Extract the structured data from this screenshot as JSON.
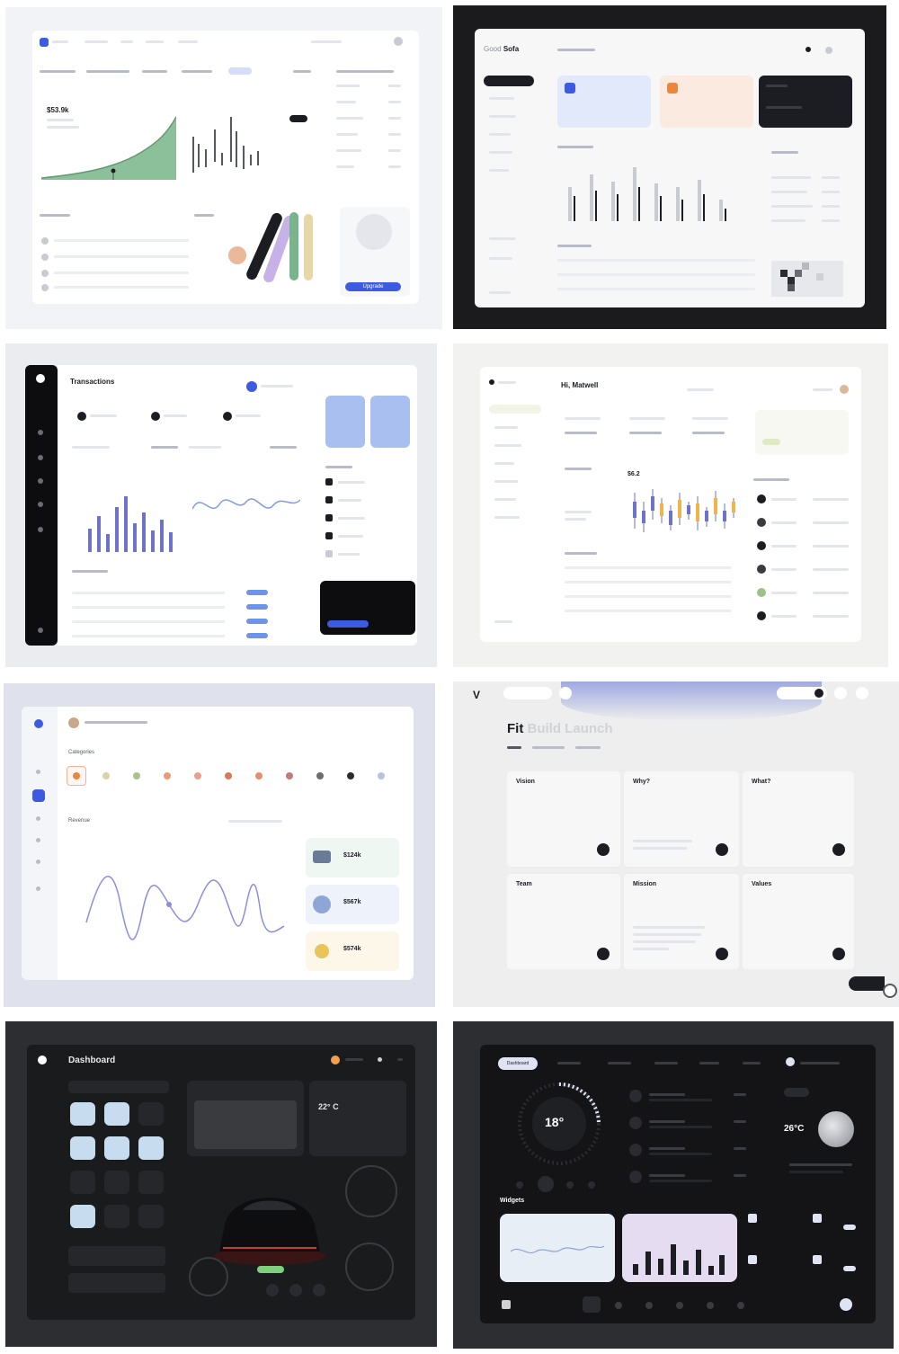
{
  "gallery": {
    "panel1": {
      "big_value": "$53.9k",
      "button_label": "Upgrade"
    },
    "panel2": {
      "logo_prefix": "Good",
      "logo_name": "Sofa"
    },
    "panel3": {
      "title": "Transactions"
    },
    "panel4": {
      "greeting": "Hi, Matwell",
      "candle_value": "$6.2"
    },
    "panel5": {
      "categories_label": "Categories",
      "chart_label": "Revenue",
      "stat_values": [
        "$124k",
        "$567k",
        "$574k"
      ]
    },
    "panel6": {
      "heading_main": "Fit",
      "heading_faded1": "Build",
      "heading_faded2": "Launch",
      "cards": [
        "Vision",
        "Why?",
        "What?",
        "Team",
        "Mission",
        "Values"
      ]
    },
    "panel7": {
      "title": "Dashboard",
      "temperature": "22° C"
    },
    "panel8": {
      "tab_active": "Dashboard",
      "dial_temp": "18°",
      "weather_temp": "26°C",
      "widgets_label": "Widgets"
    }
  },
  "colors": {
    "accent_blue": "#3d5be0",
    "accent_green": "#7ab48c",
    "accent_purple": "#8b7bd8",
    "dark_bg": "#1b1b1d",
    "tile_bg_light": "#eef0f4",
    "card_light_blue": "#c9d8f2"
  }
}
